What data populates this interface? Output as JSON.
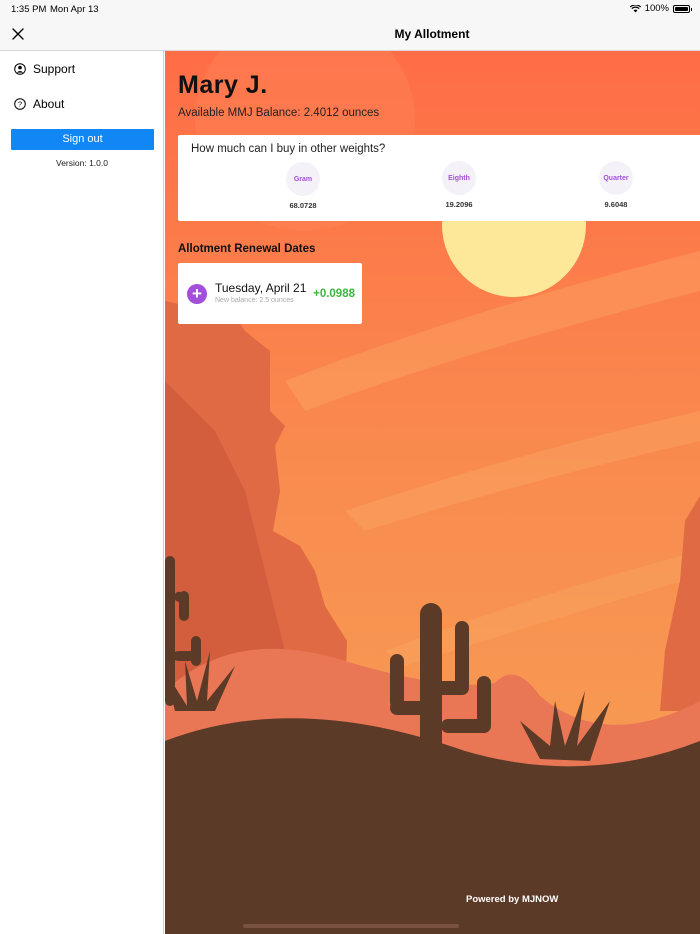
{
  "status_bar": {
    "time": "1:35 PM",
    "date": "Mon Apr 13",
    "battery": "100%"
  },
  "nav": {
    "title": "My Allotment",
    "close_icon": "close-icon"
  },
  "sidebar": {
    "items": [
      {
        "label": "Support",
        "icon": "user-circle-icon"
      },
      {
        "label": "About",
        "icon": "question-circle-icon"
      }
    ],
    "signout_label": "Sign out",
    "version": "Version: 1.0.0"
  },
  "main": {
    "user_name": "Mary J.",
    "balance_text": "Available MMJ Balance: 2.4012 ounces",
    "weights": {
      "question": "How much can I buy in other weights?",
      "items": [
        {
          "label": "Gram",
          "value": "68.0728"
        },
        {
          "label": "Eighth",
          "value": "19.2096"
        },
        {
          "label": "Quarter",
          "value": "9.6048"
        }
      ]
    },
    "renewal": {
      "title": "Allotment Renewal Dates",
      "date": "Tuesday, April 21",
      "sub": "New balance: 2.5 ounces",
      "delta": "+0.0988"
    },
    "powered_by": "Powered by MJNOW"
  },
  "colors": {
    "accent_blue": "#1187f6",
    "purple": "#a44fdc",
    "green": "#3db63e",
    "sky_top": "#ff6d47",
    "sun": "#fde89a",
    "ground": "#5c3a28"
  }
}
